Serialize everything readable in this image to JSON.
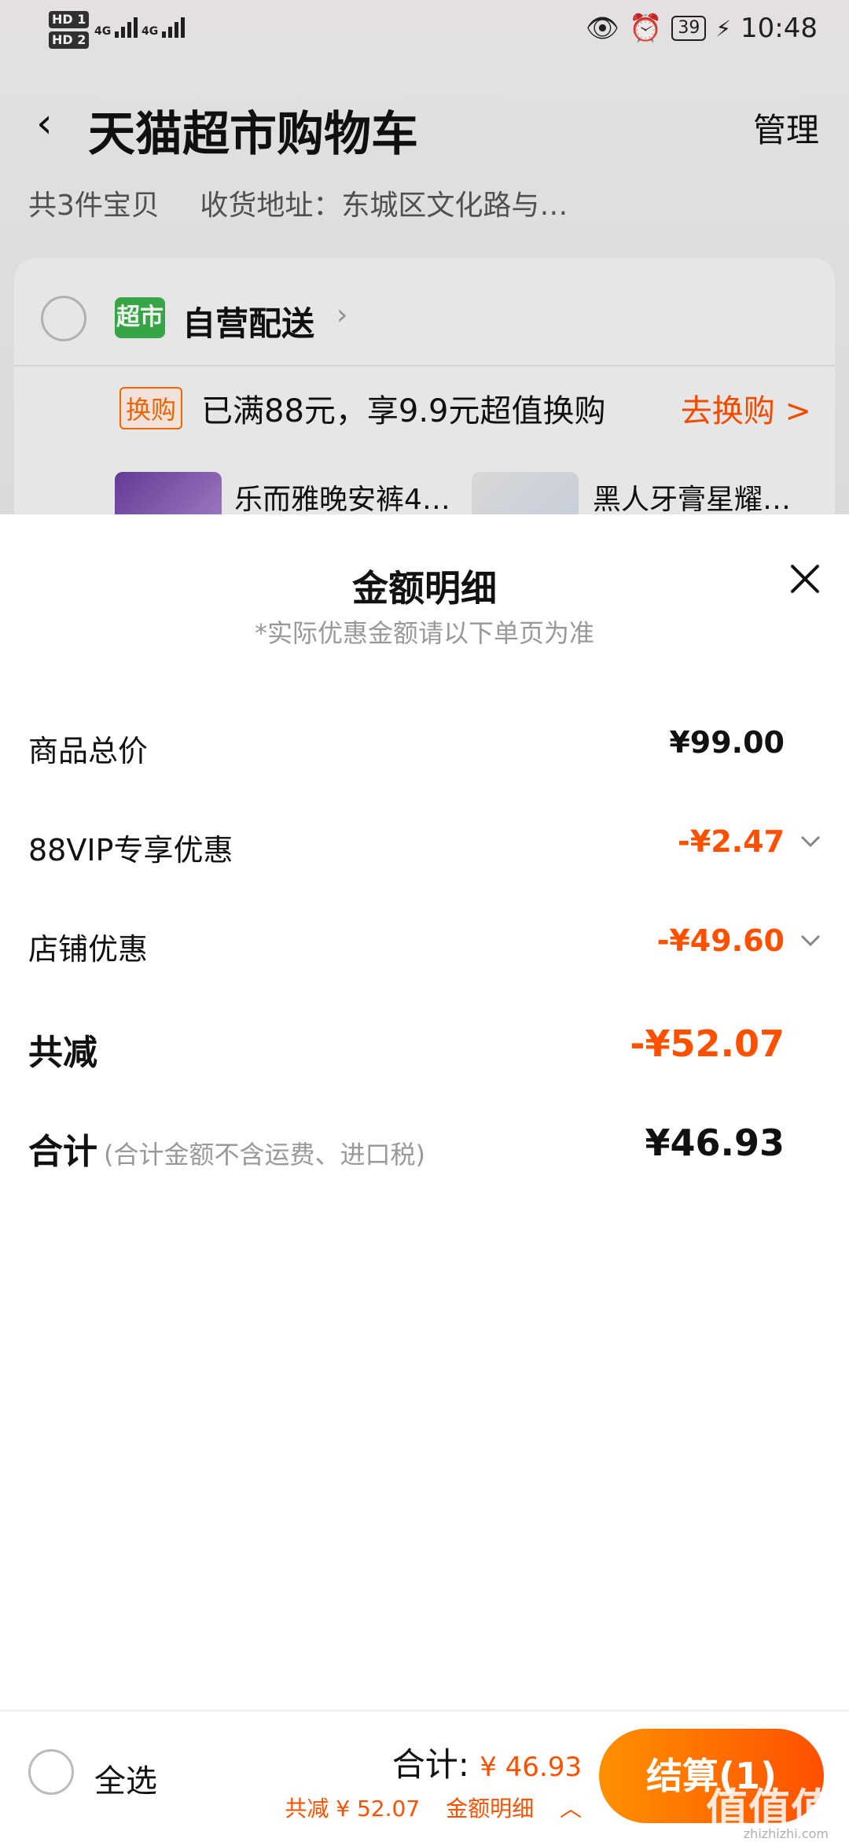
{
  "status_bar": {
    "sim1": "HD 1",
    "sim2": "HD 2",
    "network1": "4G",
    "network2": "4G",
    "battery": "39",
    "time": "10:48"
  },
  "header": {
    "title": "天猫超市购物车",
    "manage_label": "管理",
    "item_count": "共3件宝贝",
    "address": "收货地址：东城区文化路与…"
  },
  "store": {
    "badge": "超市",
    "name": "自营配送",
    "promo_tag": "换购",
    "promo_text": "已满88元，享9.9元超值换购",
    "promo_link": "去换购 >",
    "products": [
      {
        "name": "乐而雅晚安裤4…"
      },
      {
        "name": "黑人牙膏星耀…"
      }
    ]
  },
  "sheet": {
    "title": "金额明细",
    "subtitle": "*实际优惠金额请以下单页为准",
    "rows": [
      {
        "label": "商品总价",
        "amount": "¥99.00"
      },
      {
        "label": "88VIP专享优惠",
        "amount": "-¥2.47"
      },
      {
        "label": "店铺优惠",
        "amount": "-¥49.60"
      },
      {
        "label": "共减",
        "amount": "-¥52.07"
      },
      {
        "label": "合计",
        "note": "(合计金额不含运费、进口税)",
        "amount": "¥46.93"
      }
    ]
  },
  "bottom_bar": {
    "select_all": "全选",
    "total_label": "合计:",
    "total_value": "¥ 46.93",
    "saved": "共减 ¥ 52.07",
    "detail_label": "金额明细",
    "checkout_label": "结算(1)"
  },
  "watermark": {
    "text": "值值值",
    "sub": "zhizhizhi.com"
  },
  "colors": {
    "accent": "#ff5000",
    "accent_light": "#ff9000",
    "tmall_green": "#3bb04b"
  }
}
